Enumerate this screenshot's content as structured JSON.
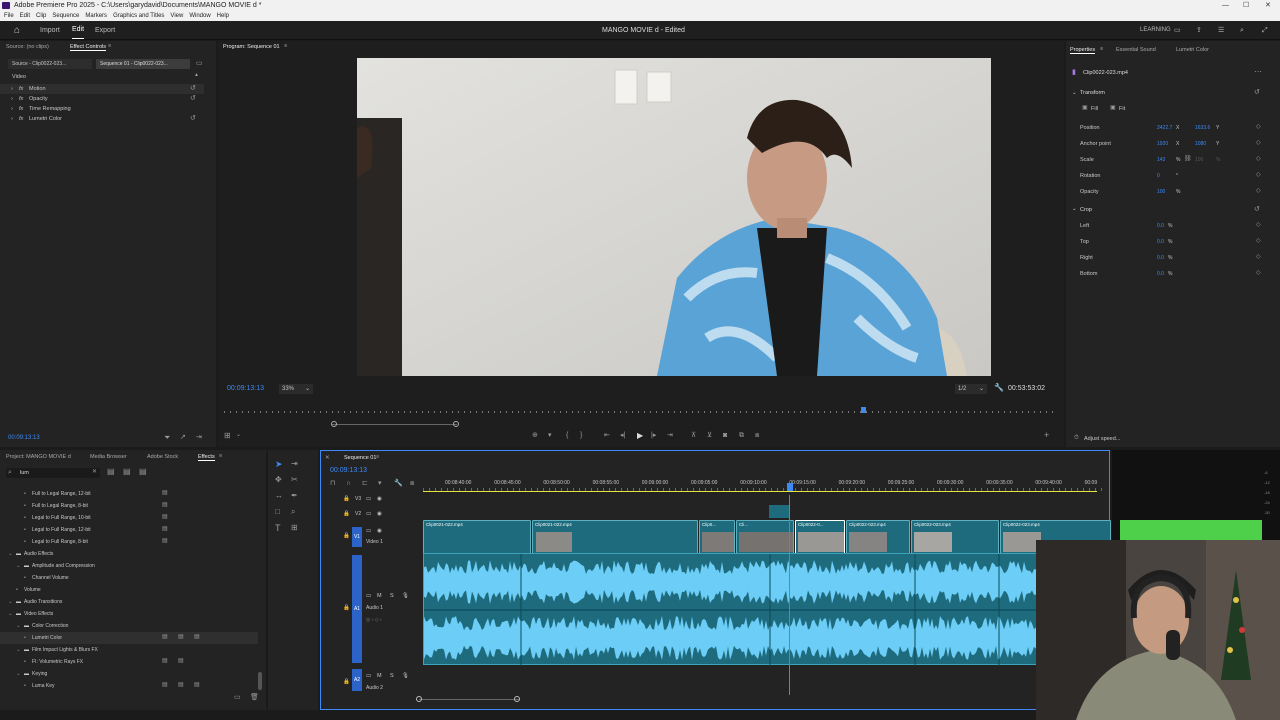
{
  "app": {
    "title": "Adobe Premiere Pro 2025 - C:\\Users\\garydavid\\Documents\\MANGO MOVIE d *"
  },
  "menu": [
    "File",
    "Edit",
    "Clip",
    "Sequence",
    "Markers",
    "Graphics and Titles",
    "View",
    "Window",
    "Help"
  ],
  "topbar": {
    "import": "Import",
    "edit": "Edit",
    "export": "Export",
    "project_title": "MANGO MOVIE d - Edited",
    "workspace": "LEARNING"
  },
  "effect_controls": {
    "tab_source": "Source: (no clips)",
    "tab_ec": "Effect Controls",
    "source_chip": "Source - Clip0022-023...",
    "seq_chip": "Sequence 01 - Clip0022-023...",
    "section": "Video",
    "items": [
      "Motion",
      "Opacity",
      "Time Remapping",
      "Lumetri Color"
    ],
    "timecode": "00:09:13:13"
  },
  "program": {
    "title": "Program: Sequence 01",
    "timecode": "00:09:13:13",
    "zoom": "33%",
    "quality": "1/2",
    "duration": "00:53:53:02"
  },
  "properties": {
    "tabs": [
      "Properties",
      "Essential Sound",
      "Lumetri Color"
    ],
    "clip_name": "Clip0022-023.mp4",
    "transform_title": "Transform",
    "fill": "Fill",
    "fit": "Fit",
    "rows": [
      {
        "label": "Position",
        "v1": "2422.7",
        "u1": "X",
        "v2": "1633.6",
        "u2": "Y"
      },
      {
        "label": "Anchor point",
        "v1": "1920",
        "u1": "X",
        "v2": "1080",
        "u2": "Y"
      },
      {
        "label": "Scale",
        "v1": "143",
        "u1": "%",
        "v2": "100",
        "u2": "%"
      },
      {
        "label": "Rotation",
        "v1": "0",
        "u1": "°",
        "v2": "",
        "u2": ""
      },
      {
        "label": "Opacity",
        "v1": "100",
        "u1": "%",
        "v2": "",
        "u2": ""
      }
    ],
    "crop_title": "Crop",
    "crop_rows": [
      {
        "label": "Left",
        "v1": "0.0",
        "u1": "%"
      },
      {
        "label": "Top",
        "v1": "0.0",
        "u1": "%"
      },
      {
        "label": "Right",
        "v1": "0.0",
        "u1": "%"
      },
      {
        "label": "Bottom",
        "v1": "0.0",
        "u1": "%"
      }
    ],
    "adjust_speed": "Adjust speed..."
  },
  "project": {
    "tabs": [
      "Project: MANGO MOVIE d",
      "Media Browser",
      "Adobe Stock",
      "Effects"
    ],
    "search": "lum",
    "tree": [
      {
        "label": "Full to Legal Range, 12-bit",
        "indent": 3
      },
      {
        "label": "Full to Legal Range, 8-bit",
        "indent": 3
      },
      {
        "label": "Legal to Full Range, 10-bit",
        "indent": 3
      },
      {
        "label": "Legal to Full Range, 12-bit",
        "indent": 3
      },
      {
        "label": "Legal to Full Range, 8-bit",
        "indent": 3
      },
      {
        "label": "Audio Effects",
        "indent": 1
      },
      {
        "label": "Amplitude and Compression",
        "indent": 2
      },
      {
        "label": "Channel Volume",
        "indent": 3
      },
      {
        "label": "Volume",
        "indent": 2
      },
      {
        "label": "Audio Transitions",
        "indent": 1
      },
      {
        "label": "Video Effects",
        "indent": 1
      },
      {
        "label": "Color Correction",
        "indent": 2
      },
      {
        "label": "Lumetri Color",
        "indent": 3
      },
      {
        "label": "Film Impact Lights & Blurs FX",
        "indent": 2
      },
      {
        "label": "FI: Volumetric Rays FX",
        "indent": 3
      },
      {
        "label": "Keying",
        "indent": 2
      },
      {
        "label": "Luma Key",
        "indent": 3
      }
    ]
  },
  "timeline": {
    "tab": "Sequence 01",
    "timecode": "00:09:13:13",
    "ruler": [
      "00:08:40:00",
      "00:08:45:00",
      "00:08:50:00",
      "00:08:55:00",
      "00:09:00:00",
      "00:09:05:00",
      "00:09:10:00",
      "00:09:15:00",
      "00:09:20:00",
      "00:09:25:00",
      "00:09:30:00",
      "00:09:35:00",
      "00:09:40:00",
      "00:09"
    ],
    "tracks": {
      "v3": "V3",
      "v2": "V2",
      "v1": "V1",
      "video1": "Video 1",
      "a1": "A1",
      "audio1": "Audio 1",
      "a2": "A2",
      "audio2": "Audio 2"
    },
    "clips": [
      "Clip0021-022.mp4",
      "Clip0021-022.mp4",
      "Clip0...",
      "Cli...",
      "Clip0022-0...",
      "Clip0022-023.mp4",
      "Clip0022-023.mp4",
      "Clip0022-023.mp4"
    ]
  },
  "meter": {
    "labels": [
      "-6",
      "-12",
      "-18",
      "-24",
      "-30"
    ]
  }
}
